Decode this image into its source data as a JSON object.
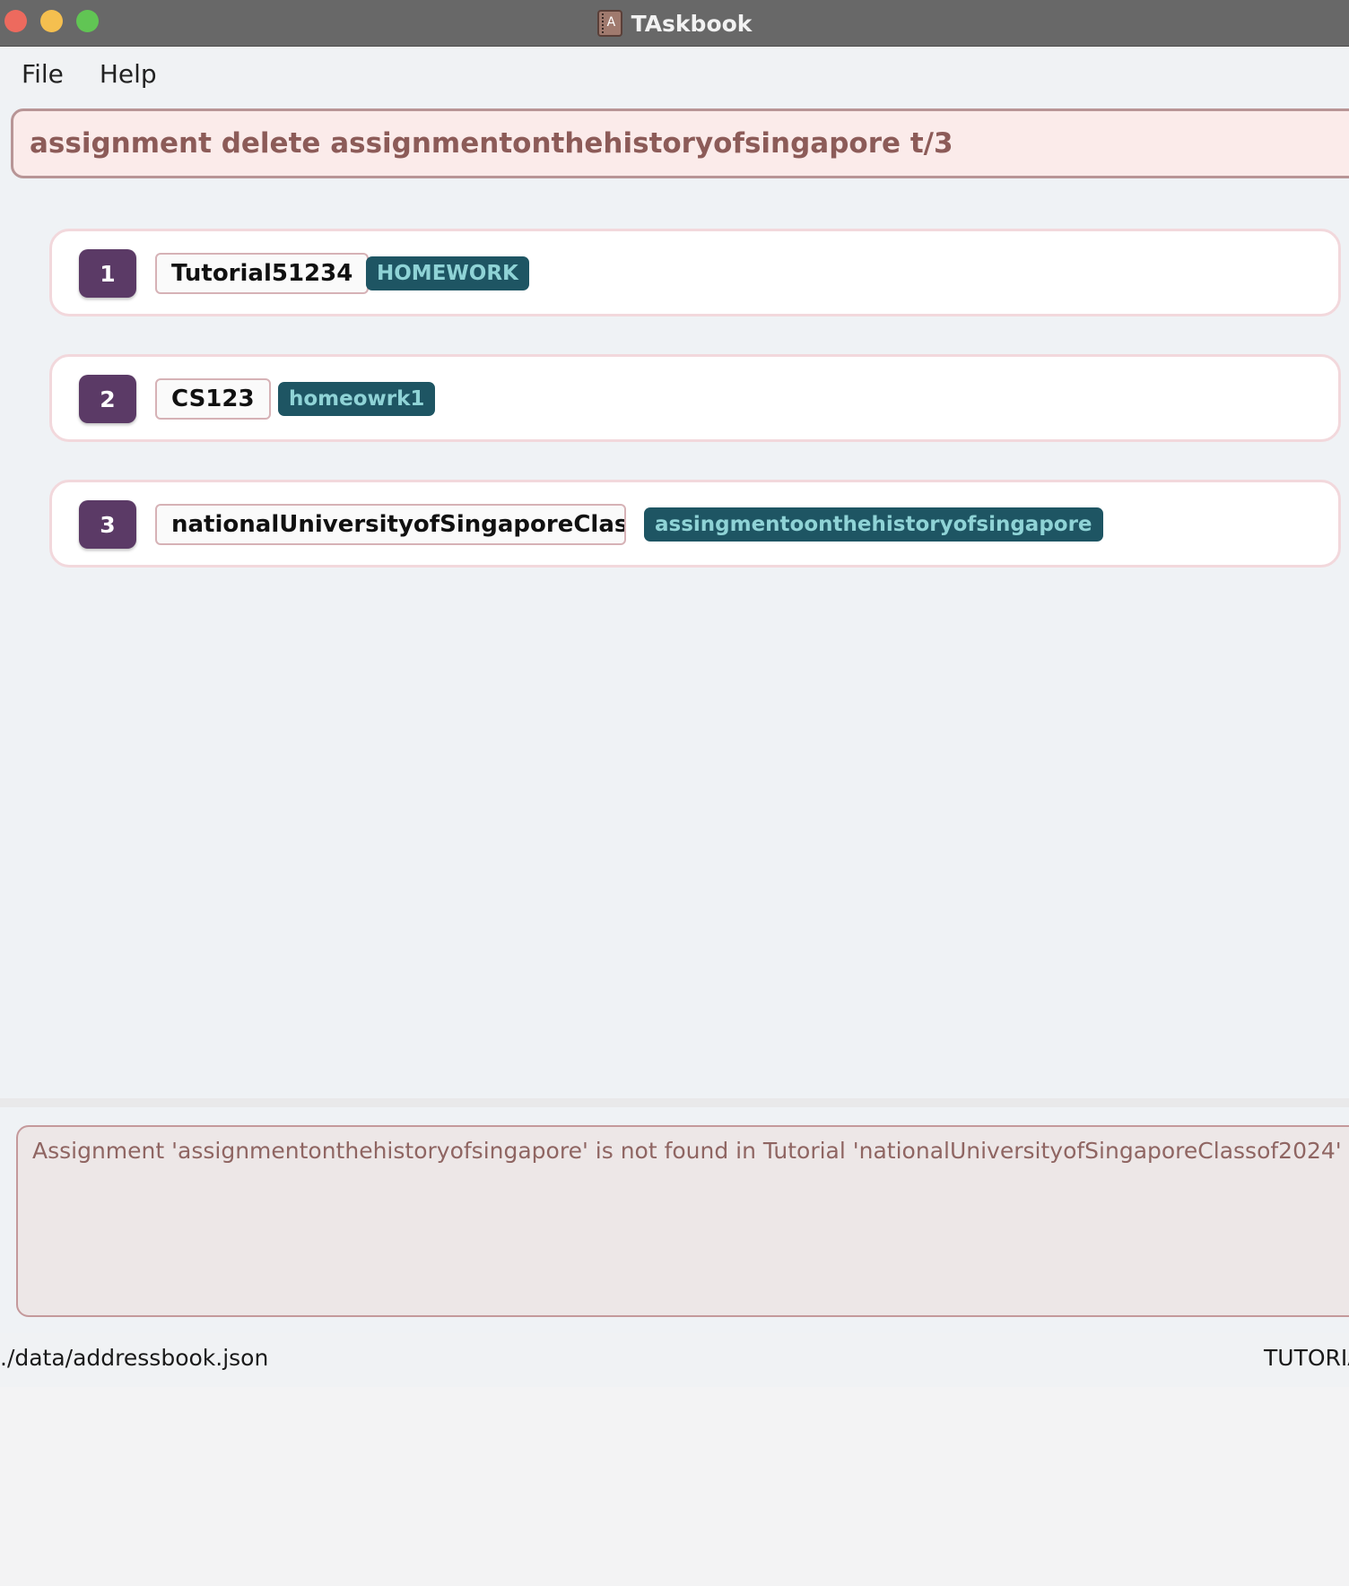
{
  "window": {
    "title": "TAskbook"
  },
  "menu": {
    "items": [
      "File",
      "Help"
    ]
  },
  "command": {
    "text": "assignment delete assignmentonthehistoryofsingapore t/3"
  },
  "tutorials": [
    {
      "index": "1",
      "name": "Tutorial51234",
      "tag": "HOMEWORK"
    },
    {
      "index": "2",
      "name": "CS123",
      "tag": "homeowrk1"
    },
    {
      "index": "3",
      "name": "nationalUniversityofSingaporeClass...",
      "tag": "assingmentoonthehistoryofsingapore"
    }
  ],
  "result": {
    "message": "Assignment 'assignmentonthehistoryofsingapore' is not found in Tutorial 'nationalUniversityofSingaporeClassof2024'"
  },
  "status": {
    "file_path": "./data/addressbook.json",
    "mode": "TUTORIA"
  },
  "colors": {
    "index_badge": "#5b3a66",
    "tag_bg": "#1e5563",
    "tag_text": "#8fd3d6",
    "command_text": "#8c5b58"
  }
}
